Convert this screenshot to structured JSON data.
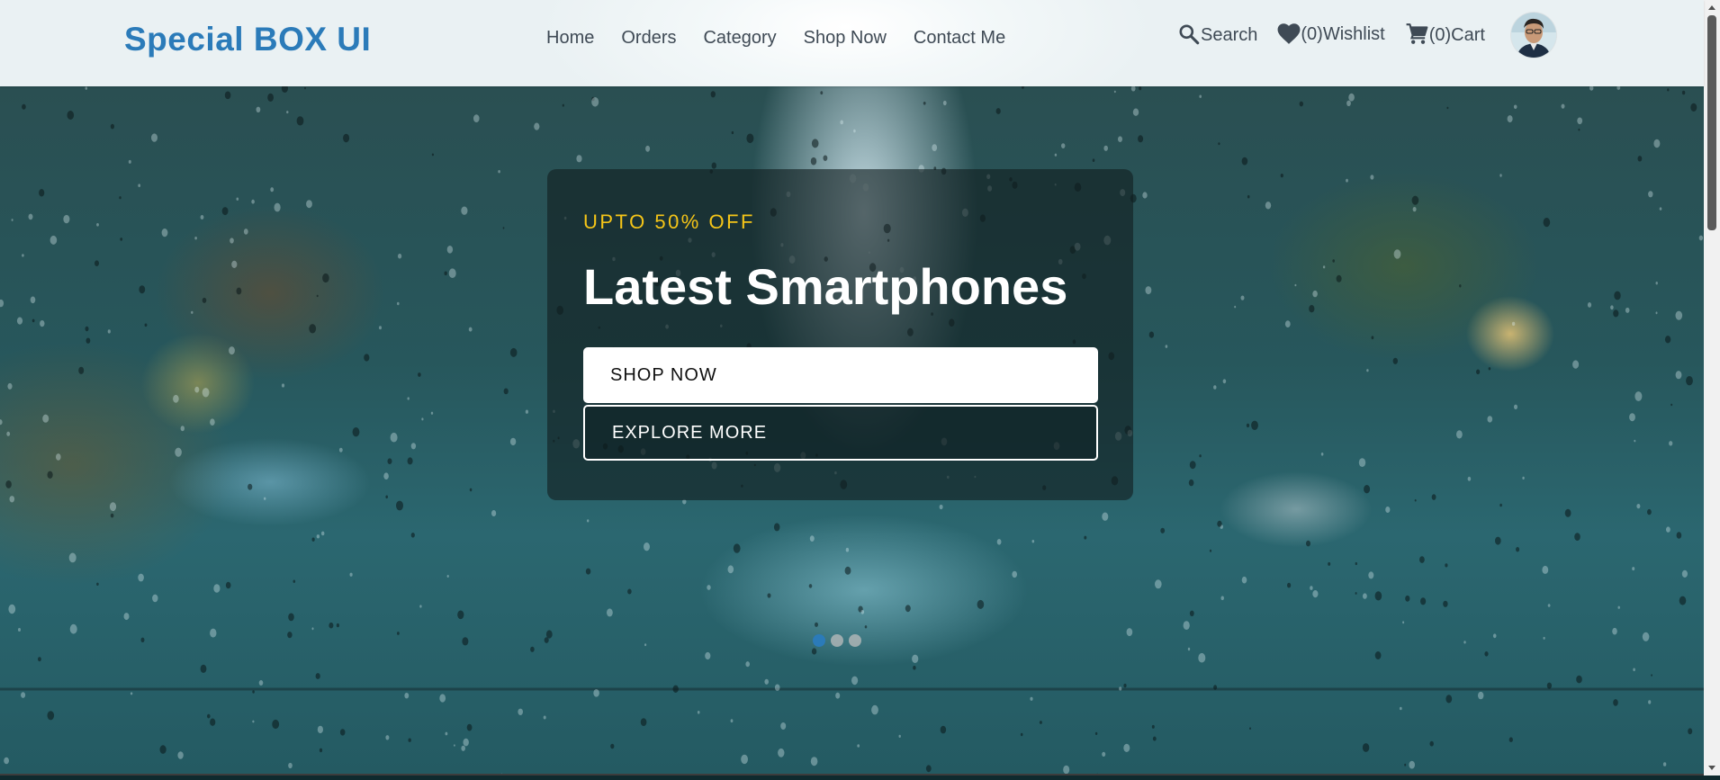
{
  "header": {
    "logo": "Special BOX UI",
    "nav": [
      "Home",
      "Orders",
      "Category",
      "Shop Now",
      "Contact Me"
    ],
    "actions": {
      "search": {
        "label": "Search",
        "icon": "search-icon"
      },
      "wishlist": {
        "count_label": "(0)",
        "label": "Wishlist",
        "icon": "heart-icon"
      },
      "cart": {
        "count_label": "(0)",
        "label": "Cart",
        "icon": "cart-icon"
      }
    },
    "avatar": "user-avatar"
  },
  "hero": {
    "promo": "UPTO 50% OFF",
    "title": "Latest Smartphones",
    "primary_button": "SHOP NOW",
    "secondary_button": "EXPLORE MORE",
    "slides": {
      "count": 3,
      "active": 1
    }
  },
  "colors": {
    "brand": "#2b7bb9",
    "promo": "#f5c518",
    "nav_text": "#3f4a55"
  }
}
